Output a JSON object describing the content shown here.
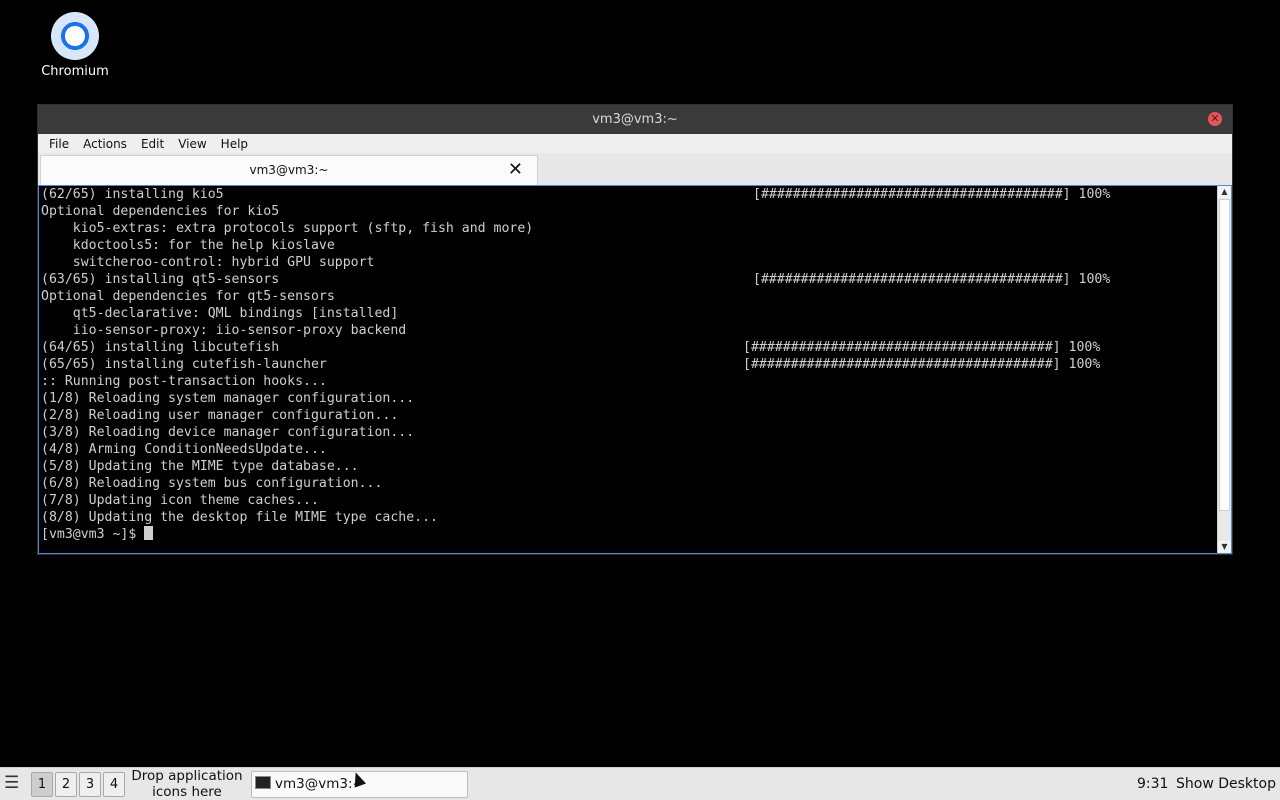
{
  "desktop": {
    "icons": [
      {
        "label": "Chromium",
        "icon": "chromium-icon"
      }
    ]
  },
  "window": {
    "title": "vm3@vm3:~",
    "close_icon": "close-icon",
    "menu": [
      "File",
      "Actions",
      "Edit",
      "View",
      "Help"
    ],
    "tab": {
      "label": "vm3@vm3:~",
      "close_glyph": "✕"
    }
  },
  "terminal": {
    "lines": [
      {
        "text": "(62/65) installing kio5",
        "progress": "[######################################] 100%"
      },
      {
        "text": "Optional dependencies for kio5",
        "progress": ""
      },
      {
        "text": "    kio5-extras: extra protocols support (sftp, fish and more)",
        "progress": ""
      },
      {
        "text": "    kdoctools5: for the help kioslave",
        "progress": ""
      },
      {
        "text": "    switcheroo-control: hybrid GPU support",
        "progress": ""
      },
      {
        "text": "(63/65) installing qt5-sensors",
        "progress": "[######################################] 100%"
      },
      {
        "text": "Optional dependencies for qt5-sensors",
        "progress": ""
      },
      {
        "text": "    qt5-declarative: QML bindings [installed]",
        "progress": ""
      },
      {
        "text": "    iio-sensor-proxy: iio-sensor-proxy backend",
        "progress": ""
      },
      {
        "text": "(64/65) installing libcutefish",
        "progress": "[######################################] 100%"
      },
      {
        "text": "(65/65) installing cutefish-launcher",
        "progress": "[######################################] 100%"
      },
      {
        "text": ":: Running post-transaction hooks...",
        "progress": ""
      },
      {
        "text": "(1/8) Reloading system manager configuration...",
        "progress": ""
      },
      {
        "text": "(2/8) Reloading user manager configuration...",
        "progress": ""
      },
      {
        "text": "(3/8) Reloading device manager configuration...",
        "progress": ""
      },
      {
        "text": "(4/8) Arming ConditionNeedsUpdate...",
        "progress": ""
      },
      {
        "text": "(5/8) Updating the MIME type database...",
        "progress": ""
      },
      {
        "text": "(6/8) Reloading system bus configuration...",
        "progress": ""
      },
      {
        "text": "(7/8) Updating icon theme caches...",
        "progress": ""
      },
      {
        "text": "(8/8) Updating the desktop file MIME type cache...",
        "progress": ""
      }
    ],
    "prompt": "[vm3@vm3 ~]$ "
  },
  "taskbar": {
    "workspaces": [
      "1",
      "2",
      "3",
      "4"
    ],
    "active_workspace": "1",
    "drop_text_line1": "Drop application",
    "drop_text_line2": "icons here",
    "task_label": "vm3@vm3:~",
    "clock": "9:31",
    "show_desktop": "Show Desktop"
  }
}
